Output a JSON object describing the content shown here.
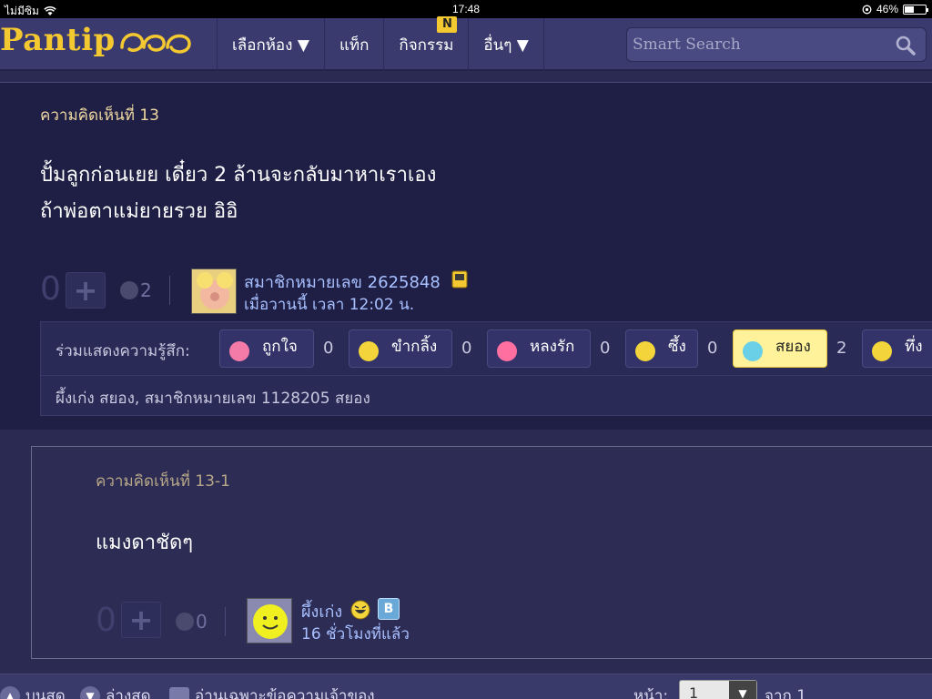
{
  "status": {
    "carrier": "ไม่มีซิม",
    "time": "17:48",
    "battery": "46%",
    "battery_level": 0.46
  },
  "nav": {
    "logo": "Pantip",
    "items": [
      {
        "label": "เลือกห้อง ▼"
      },
      {
        "label": "แท็ก"
      },
      {
        "label": "กิจกรรม",
        "badge": "N"
      },
      {
        "label": "อื่นๆ ▼"
      }
    ],
    "search_placeholder": "Smart Search"
  },
  "comment13": {
    "label": "ความคิดเห็นที่ 13",
    "lines": [
      "ปั้มลูกก่อนเยย เดี๋ยว 2 ล้านจะกลับมาหาเราเอง",
      "ถ้าพ่อตาแม่ยายรวย อิอิ"
    ],
    "vote": "0",
    "emotion_count": "2",
    "user": "สมาชิกหมายเลข 2625848",
    "time": "เมื่อวานนี้ เวลา 12:02 น.",
    "react_title": "ร่วมแสดงความรู้สึก:",
    "reactions": [
      {
        "label": "ถูกใจ",
        "count": "0",
        "color": "#f47aa8"
      },
      {
        "label": "ขำกลิ้ง",
        "count": "0",
        "color": "#f3d43a"
      },
      {
        "label": "หลงรัก",
        "count": "0",
        "color": "#ff6fa0"
      },
      {
        "label": "ซึ้ง",
        "count": "0",
        "color": "#f3d43a"
      },
      {
        "label": "สยอง",
        "count": "2",
        "color": "#6ad0e8"
      },
      {
        "label": "ทึ่ง",
        "count": "",
        "color": "#f3d43a"
      }
    ],
    "reacted_by": "ผึ้งเก่ง สยอง, สมาชิกหมายเลข 1128205 สยอง"
  },
  "comment131": {
    "label": "ความคิดเห็นที่ 13-1",
    "text": "แมงดาชัดๆ",
    "vote": "0",
    "emotion_count": "0",
    "user": "ผึ้งเก่ง",
    "badge": "B",
    "time": "16 ชั่วโมงที่แล้ว"
  },
  "bottom": {
    "top_label": "บนสุด",
    "bottom_label": "ล่างสุด",
    "owner_label": "อ่านเฉพาะข้อความเจ้าของ",
    "page_label": "หน้า:",
    "page_value": "1",
    "of_label": "จาก 1"
  }
}
